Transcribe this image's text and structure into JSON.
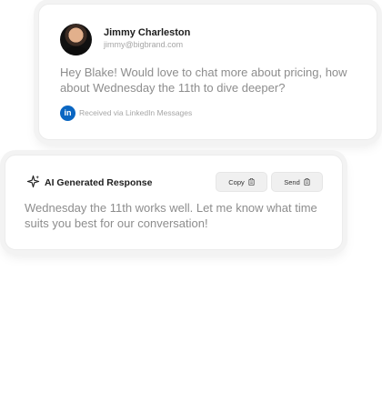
{
  "message": {
    "sender_name": "Jimmy Charleston",
    "sender_email": "jimmy@bigbrand.com",
    "body": "Hey Blake! Would love to chat more about pricing, how about Wednesday the 11th to dive deeper?",
    "linkedin_glyph": "in",
    "source": "Received via LinkedIn Messages",
    "icons": {
      "avatar": "avatar",
      "source": "linkedin-icon"
    }
  },
  "response": {
    "title": "AI Generated Response",
    "copy_label": "Copy",
    "send_label": "Send",
    "body": "Wednesday the 11th works well. Let me know what time suits you best for our conversation!",
    "icons": {
      "title": "sparkle-icon",
      "copy": "clipboard-icon",
      "send": "clipboard-icon"
    }
  },
  "colors": {
    "linkedin": "#0a66c2",
    "body_text": "#8d8d8d",
    "button_bg": "#f0f0f0"
  }
}
